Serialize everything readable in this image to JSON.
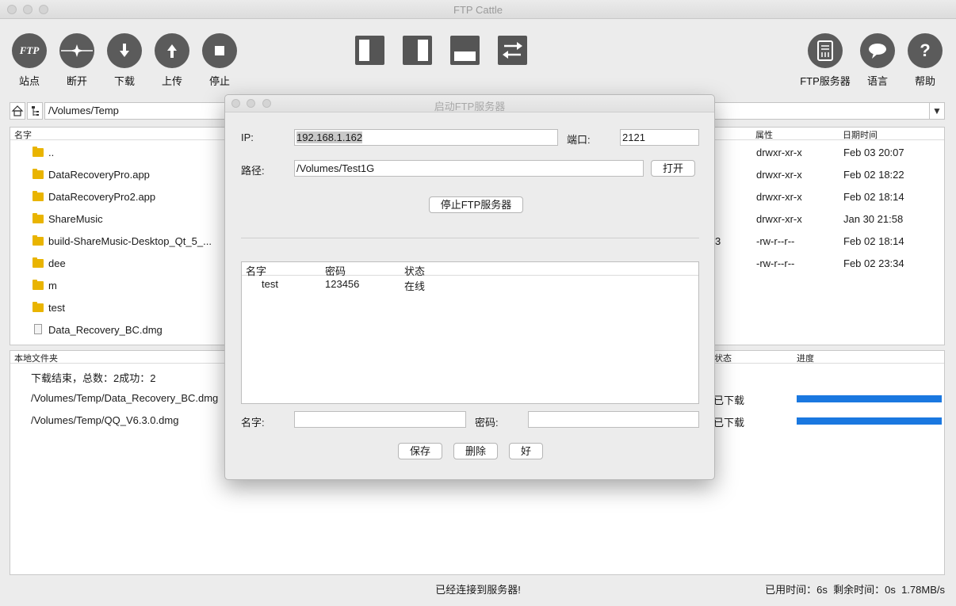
{
  "window": {
    "title": "FTP Cattle"
  },
  "toolbar": {
    "site": "站点",
    "disconnect": "断开",
    "download": "下载",
    "upload": "上传",
    "stop": "停止",
    "ftp_server": "FTP服务器",
    "language": "语言",
    "help": "帮助",
    "site_icon_text": "FTP"
  },
  "path": {
    "value": "/Volumes/Temp"
  },
  "file_list": {
    "headers": {
      "name": "名字",
      "attr": "属性",
      "datetime": "日期时间"
    },
    "rows": [
      {
        "name": "..",
        "attr": "drwxr-xr-x",
        "date": "Feb 03 20:07"
      },
      {
        "name": "DataRecoveryPro.app",
        "attr": "drwxr-xr-x",
        "date": "Feb 02 18:22"
      },
      {
        "name": "DataRecoveryPro2.app",
        "attr": "drwxr-xr-x",
        "date": "Feb 02 18:14"
      },
      {
        "name": "ShareMusic",
        "attr": "drwxr-xr-x",
        "date": "Jan 30 21:58"
      },
      {
        "name": "build-ShareMusic-Desktop_Qt_5_...",
        "attr": "-rw-r--r--",
        "date": "Feb 02 18:14"
      },
      {
        "name": "dee",
        "attr": "-rw-r--r--",
        "date": "Feb 02 23:34"
      },
      {
        "name": "m",
        "attr": "",
        "date": ""
      },
      {
        "name": "test",
        "attr": "",
        "date": ""
      },
      {
        "name": "Data_Recovery_BC.dmg",
        "attr": "",
        "date": ""
      }
    ],
    "partial_size_glyph": "3"
  },
  "transfers": {
    "headers": {
      "local": "本地文件夹",
      "status": "状态",
      "progress": "进度"
    },
    "summary": "下载结束，总数：2成功：2",
    "rows": [
      {
        "path": "/Volumes/Temp/Data_Recovery_BC.dmg",
        "status": "已下载",
        "progress": 1.0
      },
      {
        "path": "/Volumes/Temp/QQ_V6.3.0.dmg",
        "status": "已下载",
        "progress": 1.0
      }
    ]
  },
  "statusbar": {
    "center": "已经连接到服务器!",
    "right": "已用时间：6s  剩余时间：0s  1.78MB/s"
  },
  "dialog": {
    "title": "启动FTP服务器",
    "ip_label": "IP:",
    "ip_value": "192.168.1.162",
    "port_label": "端口:",
    "port_value": "2121",
    "path_label": "路径:",
    "path_value": "/Volumes/Test1G",
    "open_button": "打开",
    "stop_button": "停止FTP服务器",
    "users": {
      "headers": {
        "name": "名字",
        "password": "密码",
        "status": "状态"
      },
      "rows": [
        {
          "name": "test",
          "password": "123456",
          "status": "在线"
        }
      ]
    },
    "name_label": "名字:",
    "password_label": "密码:",
    "name_value": "",
    "password_value": "",
    "save_button": "保存",
    "delete_button": "删除",
    "ok_button": "好"
  },
  "colors": {
    "accent": "#1a78e0",
    "toolbar_icon": "#5b5b5b",
    "folder": "#e9b400"
  }
}
